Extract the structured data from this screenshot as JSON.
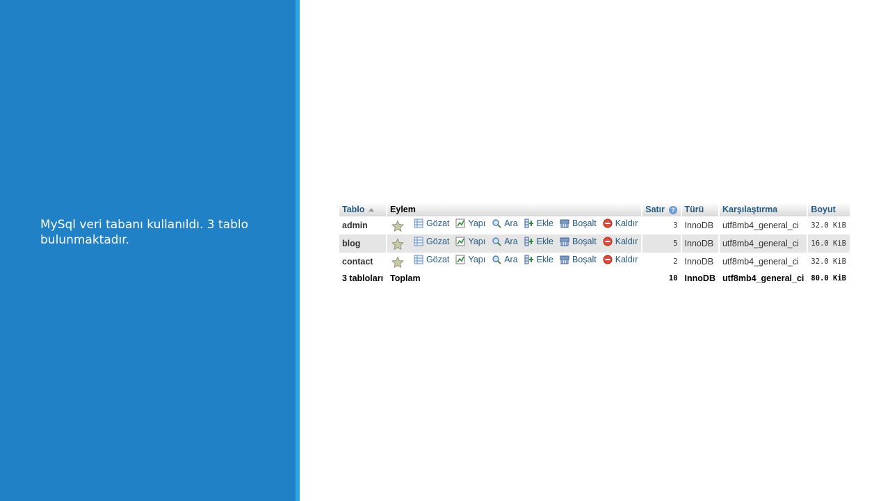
{
  "caption": {
    "line1": "MySql veri tabanı kullanıldı. 3 tablo",
    "line2": "bulunmaktadır."
  },
  "colors": {
    "panel": "#2181c6",
    "stripe": "#29a6e0",
    "link": "#235a81"
  },
  "table": {
    "headers": {
      "tablo": "Tablo",
      "eylem": "Eylem",
      "satir": "Satır",
      "turu": "Türü",
      "karsilastirma": "Karşılaştırma",
      "boyut": "Boyut"
    },
    "actions": {
      "browse": "Gözat",
      "structure": "Yapı",
      "search": "Ara",
      "insert": "Ekle",
      "empty": "Boşalt",
      "drop": "Kaldır"
    },
    "rows": [
      {
        "name": "admin",
        "rows": "3",
        "engine": "InnoDB",
        "collation": "utf8mb4_general_ci",
        "size": "32.0 KiB"
      },
      {
        "name": "blog",
        "rows": "5",
        "engine": "InnoDB",
        "collation": "utf8mb4_general_ci",
        "size": "16.0 KiB"
      },
      {
        "name": "contact",
        "rows": "2",
        "engine": "InnoDB",
        "collation": "utf8mb4_general_ci",
        "size": "32.0 KiB"
      }
    ],
    "total": {
      "label": "3 tabloları",
      "sum_label": "Toplam",
      "rows": "10",
      "engine": "InnoDB",
      "collation": "utf8mb4_general_ci",
      "size": "80.0 KiB"
    }
  }
}
